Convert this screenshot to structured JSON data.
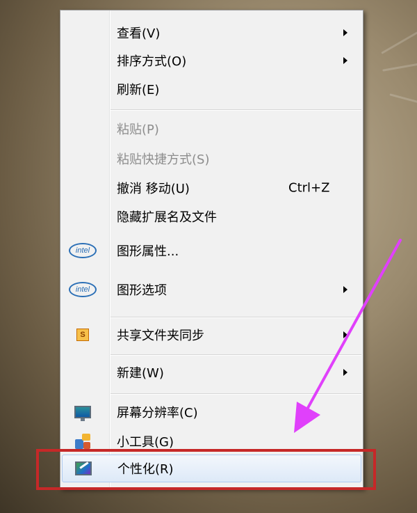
{
  "menu": {
    "items": [
      {
        "label": "查看(V)",
        "submenu": true,
        "disabled": false
      },
      {
        "label": "排序方式(O)",
        "submenu": true,
        "disabled": false
      },
      {
        "label": "刷新(E)",
        "submenu": false,
        "disabled": false
      },
      {
        "label": "粘贴(P)",
        "submenu": false,
        "disabled": true
      },
      {
        "label": "粘贴快捷方式(S)",
        "submenu": false,
        "disabled": true
      },
      {
        "label": "撤消 移动(U)",
        "shortcut": "Ctrl+Z",
        "submenu": false,
        "disabled": false
      },
      {
        "label": "隐藏扩展名及文件",
        "submenu": false,
        "disabled": false
      },
      {
        "label": "图形属性...",
        "icon": "intel-icon",
        "icon_text": "intel",
        "submenu": false,
        "disabled": false
      },
      {
        "label": "图形选项",
        "icon": "intel-icon",
        "icon_text": "intel",
        "submenu": true,
        "disabled": false
      },
      {
        "label": "共享文件夹同步",
        "icon": "sync-icon",
        "icon_text": "S",
        "submenu": true,
        "disabled": false
      },
      {
        "label": "新建(W)",
        "submenu": true,
        "disabled": false
      },
      {
        "label": "屏幕分辨率(C)",
        "icon": "monitor-icon",
        "submenu": false,
        "disabled": false
      },
      {
        "label": "小工具(G)",
        "icon": "gadgets-icon",
        "submenu": false,
        "disabled": false
      },
      {
        "label": "个性化(R)",
        "icon": "personalize-icon",
        "submenu": false,
        "disabled": false,
        "highlighted": true
      }
    ]
  },
  "colors": {
    "highlight_box": "#c62828",
    "arrow_annotation": "#e040fb",
    "menu_background": "#f1f1f1"
  }
}
